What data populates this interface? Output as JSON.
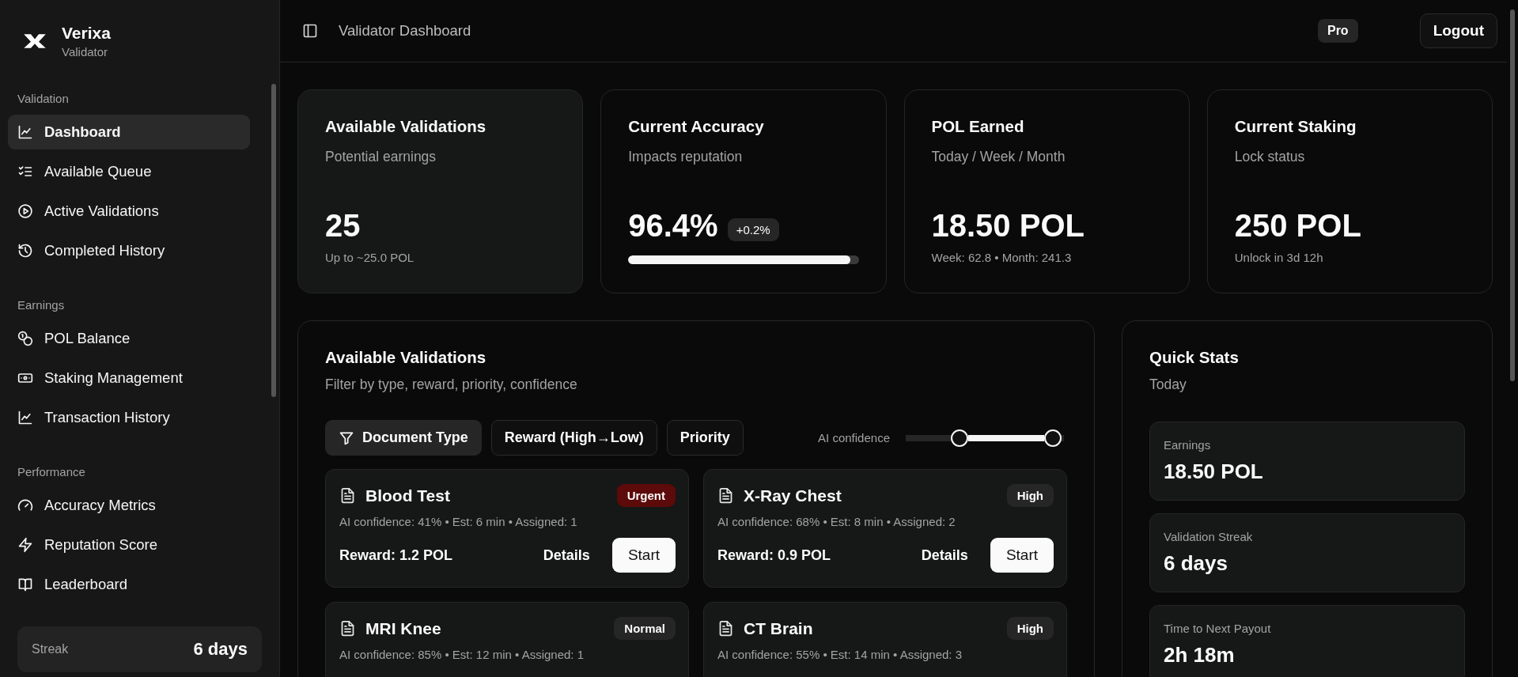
{
  "brand": {
    "name": "Verixa",
    "subtitle": "Validator"
  },
  "sidebar": {
    "groups": [
      {
        "label": "Validation",
        "items": [
          {
            "label": "Dashboard",
            "selected": true
          },
          {
            "label": "Available Queue",
            "selected": false
          },
          {
            "label": "Active Validations",
            "selected": false
          },
          {
            "label": "Completed History",
            "selected": false
          }
        ]
      },
      {
        "label": "Earnings",
        "items": [
          {
            "label": "POL Balance",
            "selected": false
          },
          {
            "label": "Staking Management",
            "selected": false
          },
          {
            "label": "Transaction History",
            "selected": false
          }
        ]
      },
      {
        "label": "Performance",
        "items": [
          {
            "label": "Accuracy Metrics",
            "selected": false
          },
          {
            "label": "Reputation Score",
            "selected": false
          },
          {
            "label": "Leaderboard",
            "selected": false
          }
        ]
      }
    ],
    "streak": {
      "label": "Streak",
      "value": "6 days"
    }
  },
  "header": {
    "title": "Validator Dashboard",
    "plan_badge": "Pro",
    "logout": "Logout"
  },
  "stat_cards": [
    {
      "title": "Available Validations",
      "subtitle": "Potential earnings",
      "value": "25",
      "note": "Up to ~25.0 POL",
      "kind": "plain"
    },
    {
      "title": "Current Accuracy",
      "subtitle": "Impacts reputation",
      "value": "96.4%",
      "change": "+0.2%",
      "level": 0.964,
      "kind": "progress"
    },
    {
      "title": "POL Earned",
      "subtitle": "Today / Week / Month",
      "value": "18.50 POL",
      "note": "Week: 62.8 • Month: 241.3",
      "kind": "plain"
    },
    {
      "title": "Current Staking",
      "subtitle": "Lock status",
      "value": "250 POL",
      "note": "Unlock in 3d 12h",
      "kind": "plain"
    }
  ],
  "validations": {
    "title": "Available Validations",
    "subtitle": "Filter by type, reward, priority, confidence",
    "filters": [
      {
        "label": "Document Type",
        "selected": true
      },
      {
        "label": "Reward (High→Low)",
        "selected": false
      },
      {
        "label": "Priority",
        "selected": false
      }
    ],
    "confidence_slider": {
      "label": "AI confidence",
      "thumbs": [
        {
          "level": 0.34
        },
        {
          "level": 0.93
        }
      ]
    },
    "items": [
      {
        "title": "Blood Test",
        "priority": {
          "label": "Urgent",
          "kind": "urgent"
        },
        "meta": "AI confidence: 41% • Est: 6 min • Assigned: 1",
        "reward": "Reward: 1.2 POL",
        "details": "Details",
        "start": "Start"
      },
      {
        "title": "X-Ray Chest",
        "priority": {
          "label": "High",
          "kind": "high"
        },
        "meta": "AI confidence: 68% • Est: 8 min • Assigned: 2",
        "reward": "Reward: 0.9 POL",
        "details": "Details",
        "start": "Start"
      },
      {
        "title": "MRI Knee",
        "priority": {
          "label": "Normal",
          "kind": "normal"
        },
        "meta": "AI confidence: 85% • Est: 12 min • Assigned: 1"
      },
      {
        "title": "CT Brain",
        "priority": {
          "label": "High",
          "kind": "high"
        },
        "meta": "AI confidence: 55% • Est: 14 min • Assigned: 3"
      }
    ]
  },
  "quick_stats": {
    "title": "Quick Stats",
    "subtitle": "Today",
    "items": [
      {
        "label": "Earnings",
        "value": "18.50 POL"
      },
      {
        "label": "Validation Streak",
        "value": "6 days"
      },
      {
        "label": "Time to Next Payout",
        "value": "2h 18m"
      }
    ]
  }
}
